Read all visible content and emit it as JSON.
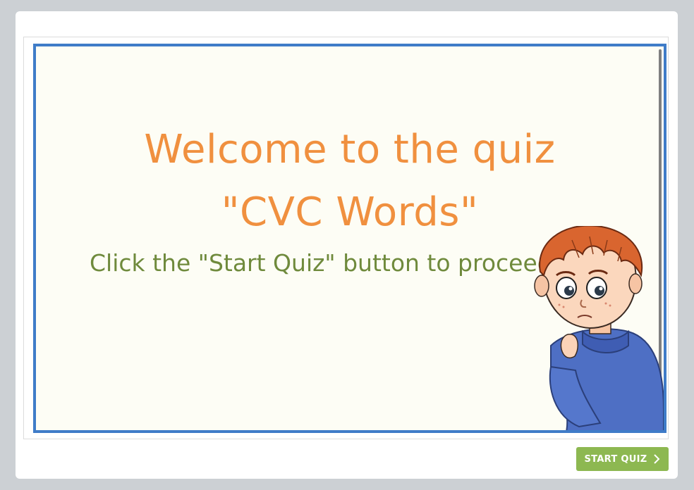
{
  "slide": {
    "title_line1": "Welcome to the quiz",
    "title_line2": "\"CVC Words\"",
    "subtitle": "Click the \"Start Quiz\" button to proceed"
  },
  "footer": {
    "start_button_label": "START QUIZ",
    "start_button_icon": "chevron-right-icon"
  },
  "colors": {
    "page_background": "#ccd0d4",
    "slide_background": "#fdfdf5",
    "slide_border": "#3f7cc8",
    "title": "#f0903f",
    "subtitle": "#6f8a3c",
    "button": "#8db851"
  }
}
